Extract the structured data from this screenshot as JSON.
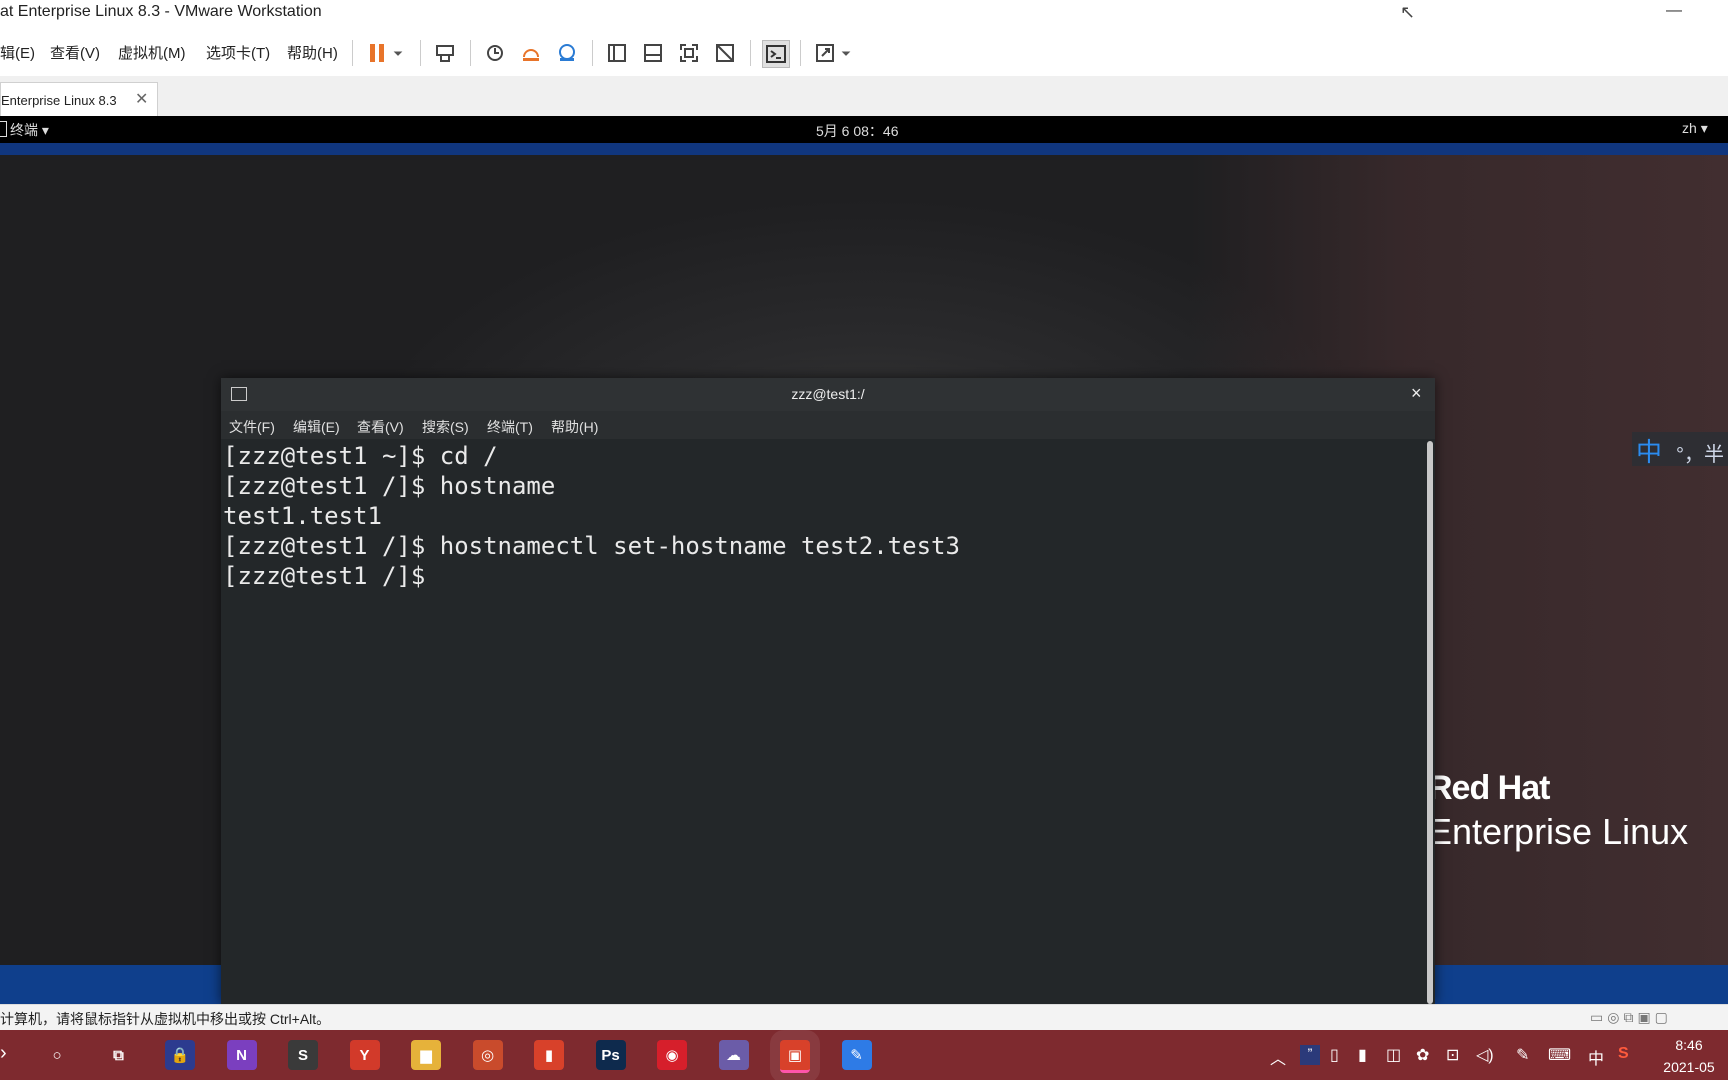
{
  "window": {
    "title": "at Enterprise Linux 8.3 - VMware Workstation",
    "minimize": "—",
    "cursor": "↖"
  },
  "menubar": {
    "items": [
      "辑(E)",
      "查看(V)",
      "虚拟机(M)",
      "选项卡(T)",
      "帮助(H)"
    ]
  },
  "toolbar": {
    "icons": [
      "pause-icon",
      "dropdown-icon",
      "send-keys-icon",
      "snapshot-icon",
      "revert-icon",
      "snapshot-manager-icon",
      "sidebar-icon",
      "thumbnail-icon",
      "fullscreen-icon",
      "unity-icon",
      "console-icon",
      "stretch-icon"
    ],
    "accent_color": "#e8742a"
  },
  "tab": {
    "label": "Enterprise Linux 8.3",
    "close": "✕"
  },
  "gnome": {
    "activities": "终端",
    "datetime": "5月 6  08：46",
    "lang": "zh"
  },
  "desktop": {
    "brand_line1": "Red Hat",
    "brand_line2": "Enterprise Linux",
    "ime_zh": "中",
    "ime_rest": "°，半"
  },
  "terminal": {
    "title": "zzz@test1:/",
    "close": "×",
    "menu": [
      "文件(F)",
      "编辑(E)",
      "查看(V)",
      "搜索(S)",
      "终端(T)",
      "帮助(H)"
    ],
    "lines": [
      "[zzz@test1 ~]$ cd /",
      "[zzz@test1 /]$ hostname",
      "test1.test1",
      "[zzz@test1 /]$ hostnamectl set-hostname test2.test3",
      "[zzz@test1 /]$ "
    ]
  },
  "statusbar": {
    "text": "计算机，请将鼠标指针从虚拟机中移出或按 Ctrl+Alt。"
  },
  "taskbar": {
    "apps": [
      {
        "name": "search-icon",
        "glyph": "○"
      },
      {
        "name": "taskview-icon",
        "glyph": "⧉"
      },
      {
        "name": "lock-app-icon",
        "glyph": "🔒"
      },
      {
        "name": "onenote-icon",
        "glyph": "N"
      },
      {
        "name": "sublime-icon",
        "glyph": "S"
      },
      {
        "name": "yandex-icon",
        "glyph": "Y"
      },
      {
        "name": "file-explorer-icon",
        "glyph": "▆"
      },
      {
        "name": "snail-icon",
        "glyph": "◎"
      },
      {
        "name": "office-icon",
        "glyph": "▮"
      },
      {
        "name": "photoshop-icon",
        "glyph": "Ps"
      },
      {
        "name": "netease-music-icon",
        "glyph": "◉"
      },
      {
        "name": "cloud-icon",
        "glyph": "☁"
      },
      {
        "name": "vmware-icon",
        "glyph": "▣"
      },
      {
        "name": "feishu-icon",
        "glyph": "✎"
      }
    ],
    "tray_lang": "中",
    "time": "8:46",
    "date": "2021-05"
  }
}
